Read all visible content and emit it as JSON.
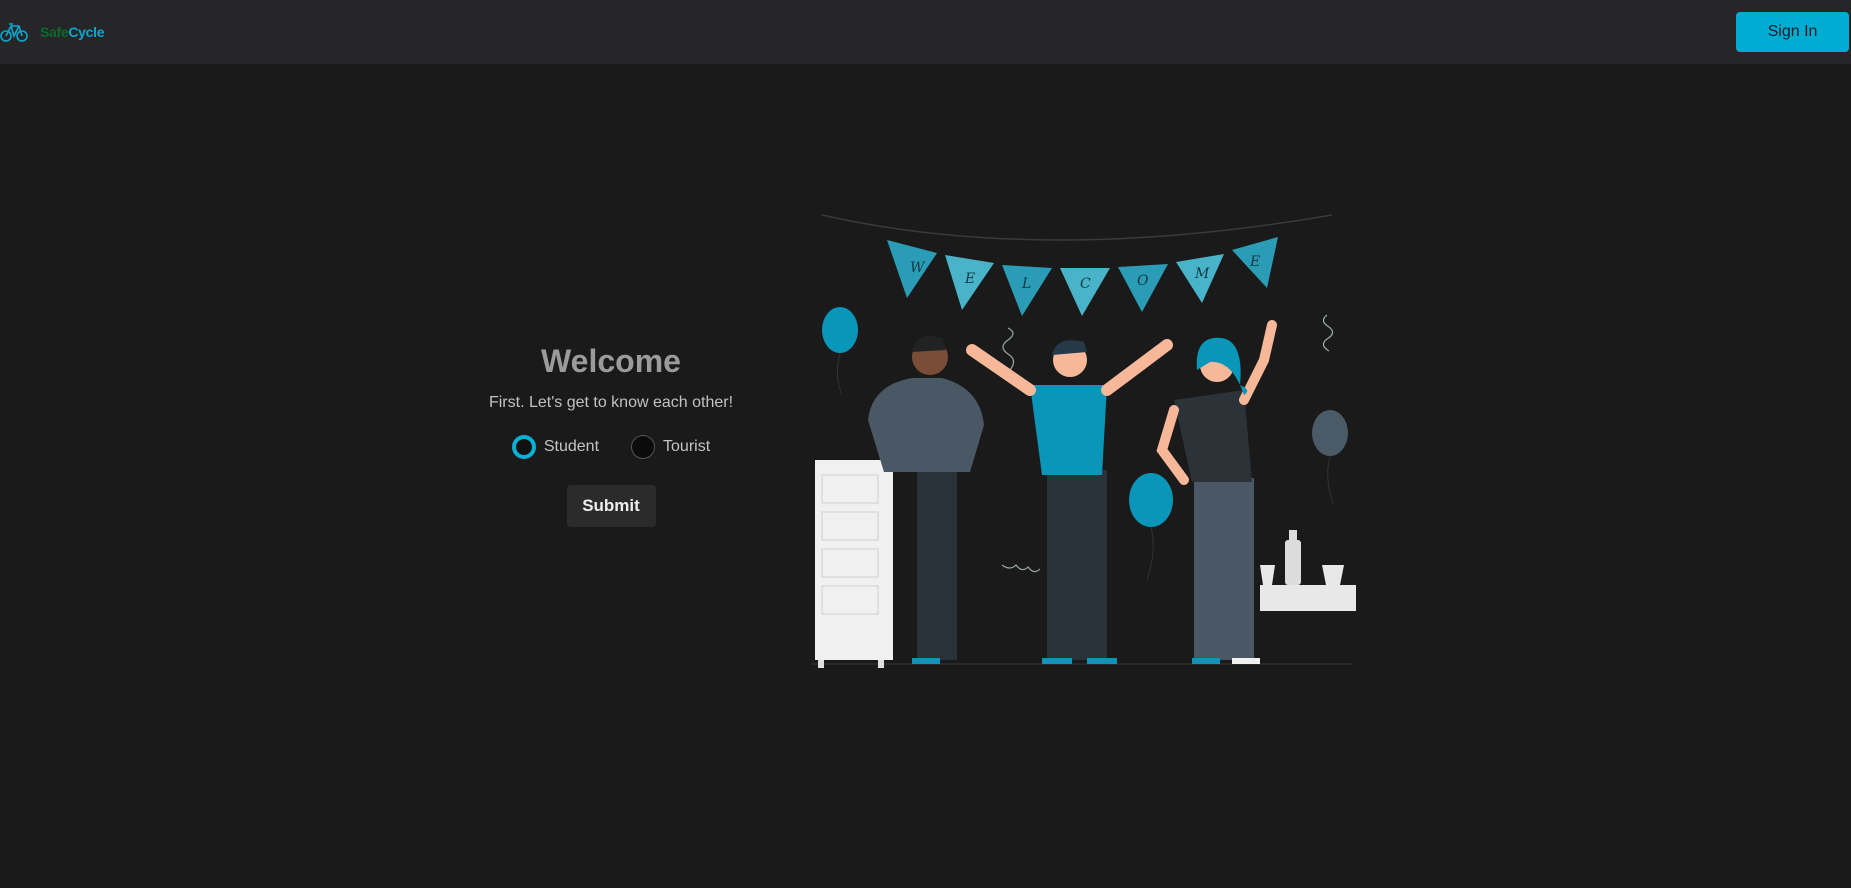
{
  "navbar": {
    "logo_part1": "Safe",
    "logo_part2": "Cycle",
    "logo_icon": "bicycle-icon",
    "signin_label": "Sign In"
  },
  "form": {
    "title": "Welcome",
    "subtitle": "First. Let's get to know each other!",
    "options": [
      {
        "label": "Student",
        "selected": true
      },
      {
        "label": "Tourist",
        "selected": false
      }
    ],
    "submit_label": "Submit"
  },
  "illustration": {
    "banner_letters": [
      "W",
      "E",
      "L",
      "C",
      "O",
      "M",
      "E"
    ]
  },
  "colors": {
    "accent": "#00acd2",
    "background": "#1a1a1a",
    "navbar": "#262628"
  }
}
